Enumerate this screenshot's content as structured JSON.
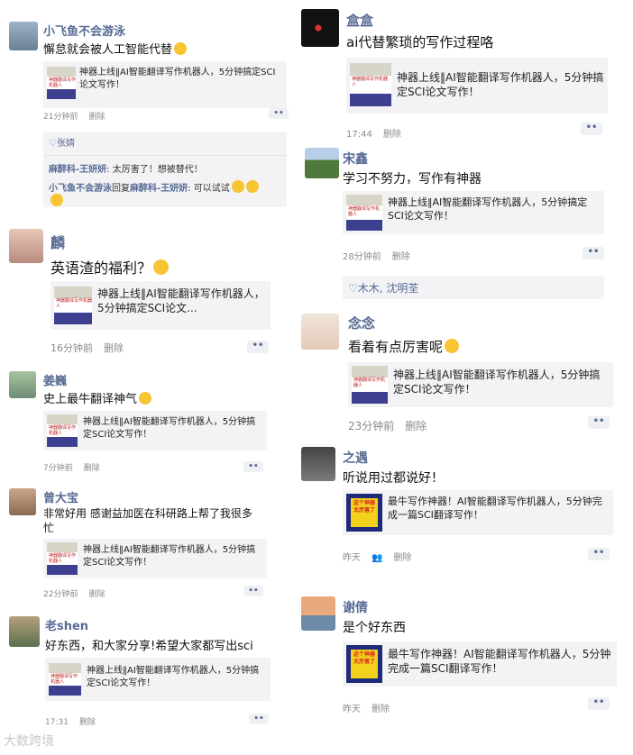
{
  "link_a_thumb_text": "神器翻译写作机器人",
  "link_b_thumb_text": "这个神器 太厉害了",
  "more_glyph": "••",
  "posts": [
    {
      "name": "小飞鱼不会游泳",
      "text": "懈怠就会被人工智能代替",
      "time": "21分钟前",
      "delete": "删除",
      "link": "神器上线‖AI智能翻译写作机器人，5分钟搞定SCI论文写作！",
      "likes": "张婧",
      "comments": [
        {
          "from": "麻醉科-王妍妍",
          "to": "",
          "text": "太厉害了！想被替代！"
        },
        {
          "from": "小飞鱼不会游泳",
          "mid": "回复",
          "to": "麻醉科-王妍妍",
          "text": "可以试试"
        }
      ]
    },
    {
      "name": "麟",
      "text": "英语渣的福利？",
      "time": "16分钟前",
      "delete": "删除",
      "link": "神器上线‖AI智能翻译写作机器人，5分钟搞定SCI论文..."
    },
    {
      "name": "姜巍",
      "text": "史上最牛翻译神气",
      "time": "7分钟前",
      "delete": "删除",
      "link": "神器上线‖AI智能翻译写作机器人，5分钟搞定SCI论文写作！"
    },
    {
      "name": "曾大宝",
      "text": "非常好用 感谢益加医在科研路上帮了我很多忙",
      "time": "22分钟前",
      "delete": "删除",
      "link": "神器上线‖AI智能翻译写作机器人，5分钟搞定SCI论文写作！"
    },
    {
      "name": "老shen",
      "text": "好东西，和大家分享!希望大家都写出sci",
      "time": "17:31",
      "delete": "删除",
      "link": "神器上线‖AI智能翻译写作机器人，5分钟搞定SCI论文写作！"
    },
    {
      "name": "盒盒",
      "text": "ai代替繁琐的写作过程咯",
      "time": "17:44",
      "delete": "删除",
      "link": "神器上线‖AI智能翻译写作机器人，5分钟搞定SCI论文写作！"
    },
    {
      "name": "宋鑫",
      "text": "学习不努力，写作有神器",
      "time": "28分钟前",
      "delete": "删除",
      "link": "神器上线‖AI智能翻译写作机器人，5分钟搞定SCI论文写作！",
      "likes": "木木, 沈明荃"
    },
    {
      "name": "念念",
      "text": "看着有点厉害呢",
      "time": "23分钟前",
      "delete": "删除",
      "link": "神器上线‖AI智能翻译写作机器人，5分钟搞定SCI论文写作！"
    },
    {
      "name": "之遇",
      "text": "听说用过都说好！",
      "time": "昨天",
      "delete": "删除",
      "link": "最牛写作神器！AI智能翻译写作机器人，5分钟完成一篇SCI翻译写作！"
    },
    {
      "name": "谢倩",
      "text": "是个好东西",
      "time": "昨天",
      "delete": "删除",
      "link": "最牛写作神器！AI智能翻译写作机器人，5分钟完成一篇SCI翻译写作！"
    }
  ],
  "watermark": "大数跨境"
}
